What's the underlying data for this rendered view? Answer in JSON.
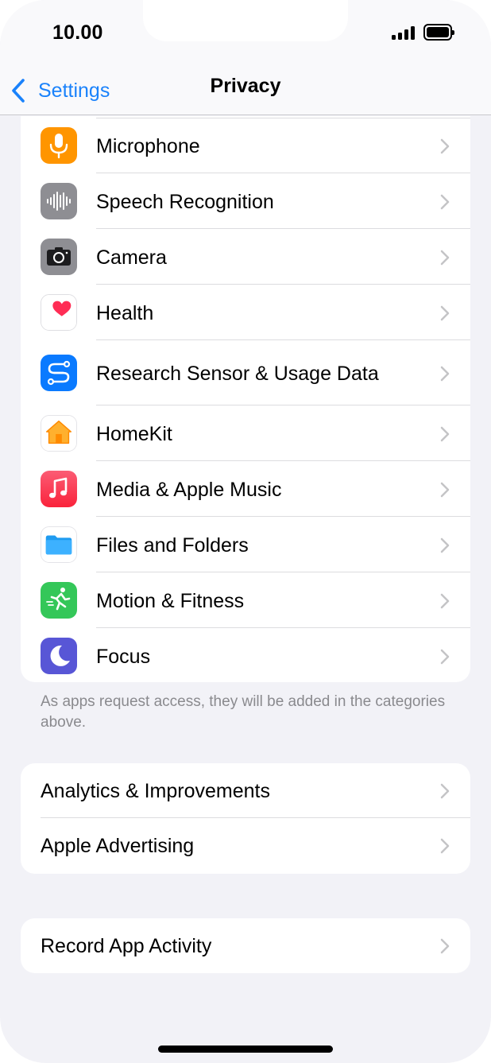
{
  "status_bar": {
    "time": "10.00"
  },
  "nav": {
    "back_label": "Settings",
    "title": "Privacy"
  },
  "main_list": {
    "items": [
      {
        "label": "Microphone",
        "icon": "microphone-icon",
        "color": "#ff9500"
      },
      {
        "label": "Speech Recognition",
        "icon": "waveform-icon",
        "color": "#8e8e93"
      },
      {
        "label": "Camera",
        "icon": "camera-icon",
        "color": "#8e8e93"
      },
      {
        "label": "Health",
        "icon": "heart-icon",
        "color": "#ff2d55"
      },
      {
        "label": "Research Sensor & Usage Data",
        "icon": "research-icon",
        "color": "#0a7aff"
      },
      {
        "label": "HomeKit",
        "icon": "home-icon",
        "color": "#ff9f0a"
      },
      {
        "label": "Media & Apple Music",
        "icon": "music-note-icon",
        "color": "#fc3c44"
      },
      {
        "label": "Files and Folders",
        "icon": "folder-icon",
        "color": "#1e9bf0"
      },
      {
        "label": "Motion & Fitness",
        "icon": "running-figure-icon",
        "color": "#34c759"
      },
      {
        "label": "Focus",
        "icon": "moon-icon",
        "color": "#5856d6"
      }
    ],
    "footer": "As apps request access, they will be added in the categories above."
  },
  "secondary_list": {
    "items": [
      {
        "label": "Analytics & Improvements"
      },
      {
        "label": "Apple Advertising"
      }
    ]
  },
  "activity_list": {
    "items": [
      {
        "label": "Record App Activity"
      }
    ]
  },
  "colors": {
    "accent": "#1a82fb",
    "background": "#f2f2f7",
    "chevron": "#c4c4c6",
    "footer_text": "#8a8a8e"
  }
}
